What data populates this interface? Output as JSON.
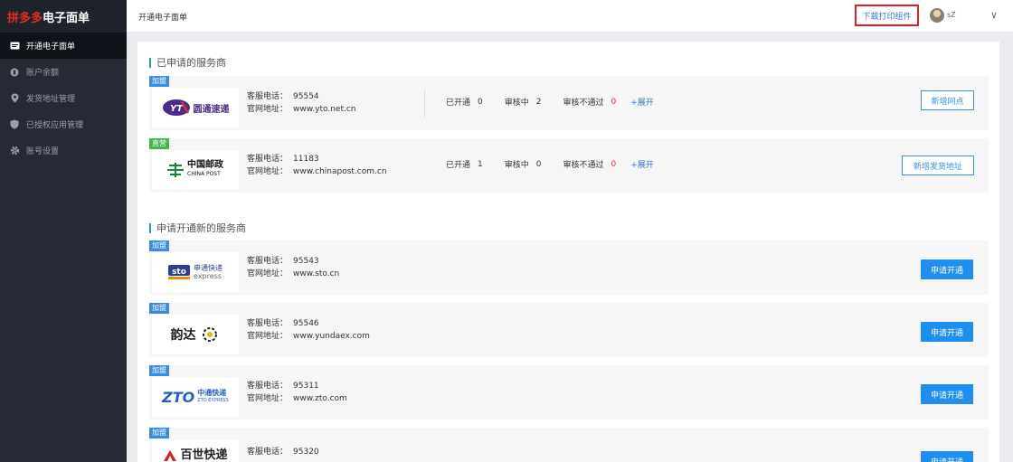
{
  "brand": {
    "part1": "拼多多",
    "part2": "电子面单"
  },
  "sidebar": {
    "items": [
      {
        "label": "开通电子面单",
        "icon": "waybill-icon"
      },
      {
        "label": "账户余额",
        "icon": "balance-icon"
      },
      {
        "label": "发货地址管理",
        "icon": "location-icon"
      },
      {
        "label": "已授权应用管理",
        "icon": "shield-icon"
      },
      {
        "label": "账号设置",
        "icon": "gear-icon"
      }
    ]
  },
  "header": {
    "breadcrumb": "开通电子面单",
    "download_label": "下载打印组件",
    "username": "sZ",
    "chevron": "∨"
  },
  "applied": {
    "title": "已申请的服务商",
    "labels": {
      "phone": "客服电话：",
      "site": "官网地址：",
      "opened": "已开通",
      "reviewing": "审核中",
      "rejected": "审核不通过",
      "expand": "+展开"
    },
    "items": [
      {
        "tag": "加盟",
        "logo_cn": "圆通速递",
        "logo_en": "YTO",
        "phone": "95554",
        "site": "www.yto.net.cn",
        "opened": "0",
        "reviewing": "2",
        "rejected": "0",
        "action": "新增网点"
      },
      {
        "tag": "直营",
        "logo_cn": "中国邮政",
        "logo_en": "CHINA POST",
        "phone": "11183",
        "site": "www.chinapost.com.cn",
        "opened": "1",
        "reviewing": "0",
        "rejected": "0",
        "action": "新增发货地址"
      }
    ]
  },
  "new": {
    "title": "申请开通新的服务商",
    "apply_label": "申请开通",
    "items": [
      {
        "tag": "加盟",
        "logo_cn": "申通快递",
        "logo_en": "express",
        "phone": "95543",
        "site": "www.sto.cn"
      },
      {
        "tag": "加盟",
        "logo_cn": "韵达",
        "logo_en": "",
        "phone": "95546",
        "site": "www.yundaex.com"
      },
      {
        "tag": "加盟",
        "logo_cn": "中通快递",
        "logo_en": "ZTO EXPRESS",
        "phone": "95311",
        "site": "www.zto.com"
      },
      {
        "tag": "加盟",
        "logo_cn": "百世快递",
        "logo_en": "",
        "phone": "95320",
        "site": ""
      }
    ]
  },
  "colors": {
    "brand_red": "#e02e24",
    "accent_blue": "#1e8ff0",
    "sidebar_bg": "#252a34"
  }
}
